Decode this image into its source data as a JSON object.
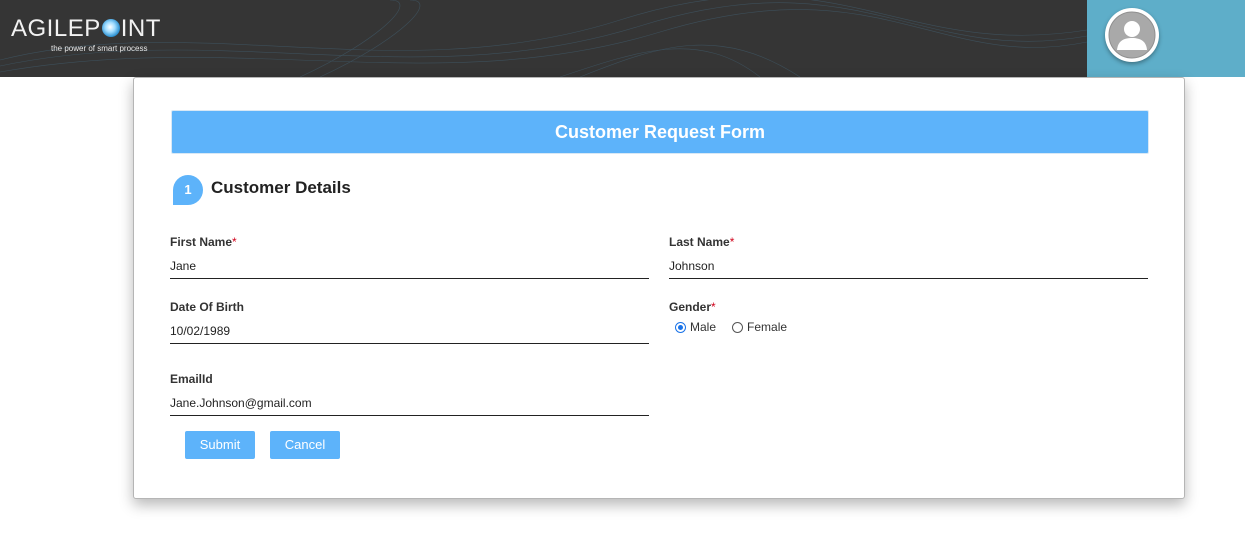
{
  "header": {
    "logo_text_pre": "AGILEP",
    "logo_text_post": "INT",
    "logo_tagline": "the power of smart process",
    "user_avatar_icon": "user-avatar-icon"
  },
  "form": {
    "title": "Customer Request Form",
    "section": {
      "number": "1",
      "title": "Customer Details"
    },
    "fields": {
      "first_name": {
        "label": "First Name",
        "required_mark": "*",
        "value": "Jane"
      },
      "last_name": {
        "label": "Last Name",
        "required_mark": "*",
        "value": "Johnson"
      },
      "dob": {
        "label": "Date Of Birth",
        "value": "10/02/1989"
      },
      "gender": {
        "label": "Gender",
        "required_mark": "*",
        "options": [
          "Male",
          "Female"
        ],
        "selected": "Male"
      },
      "email": {
        "label": "EmailId",
        "value": "Jane.Johnson@gmail.com"
      }
    },
    "buttons": {
      "submit": "Submit",
      "cancel": "Cancel"
    }
  },
  "colors": {
    "header_bg": "#353535",
    "user_panel_bg": "#5eaec9",
    "accent": "#5db3fa",
    "required": "#d0021b"
  }
}
